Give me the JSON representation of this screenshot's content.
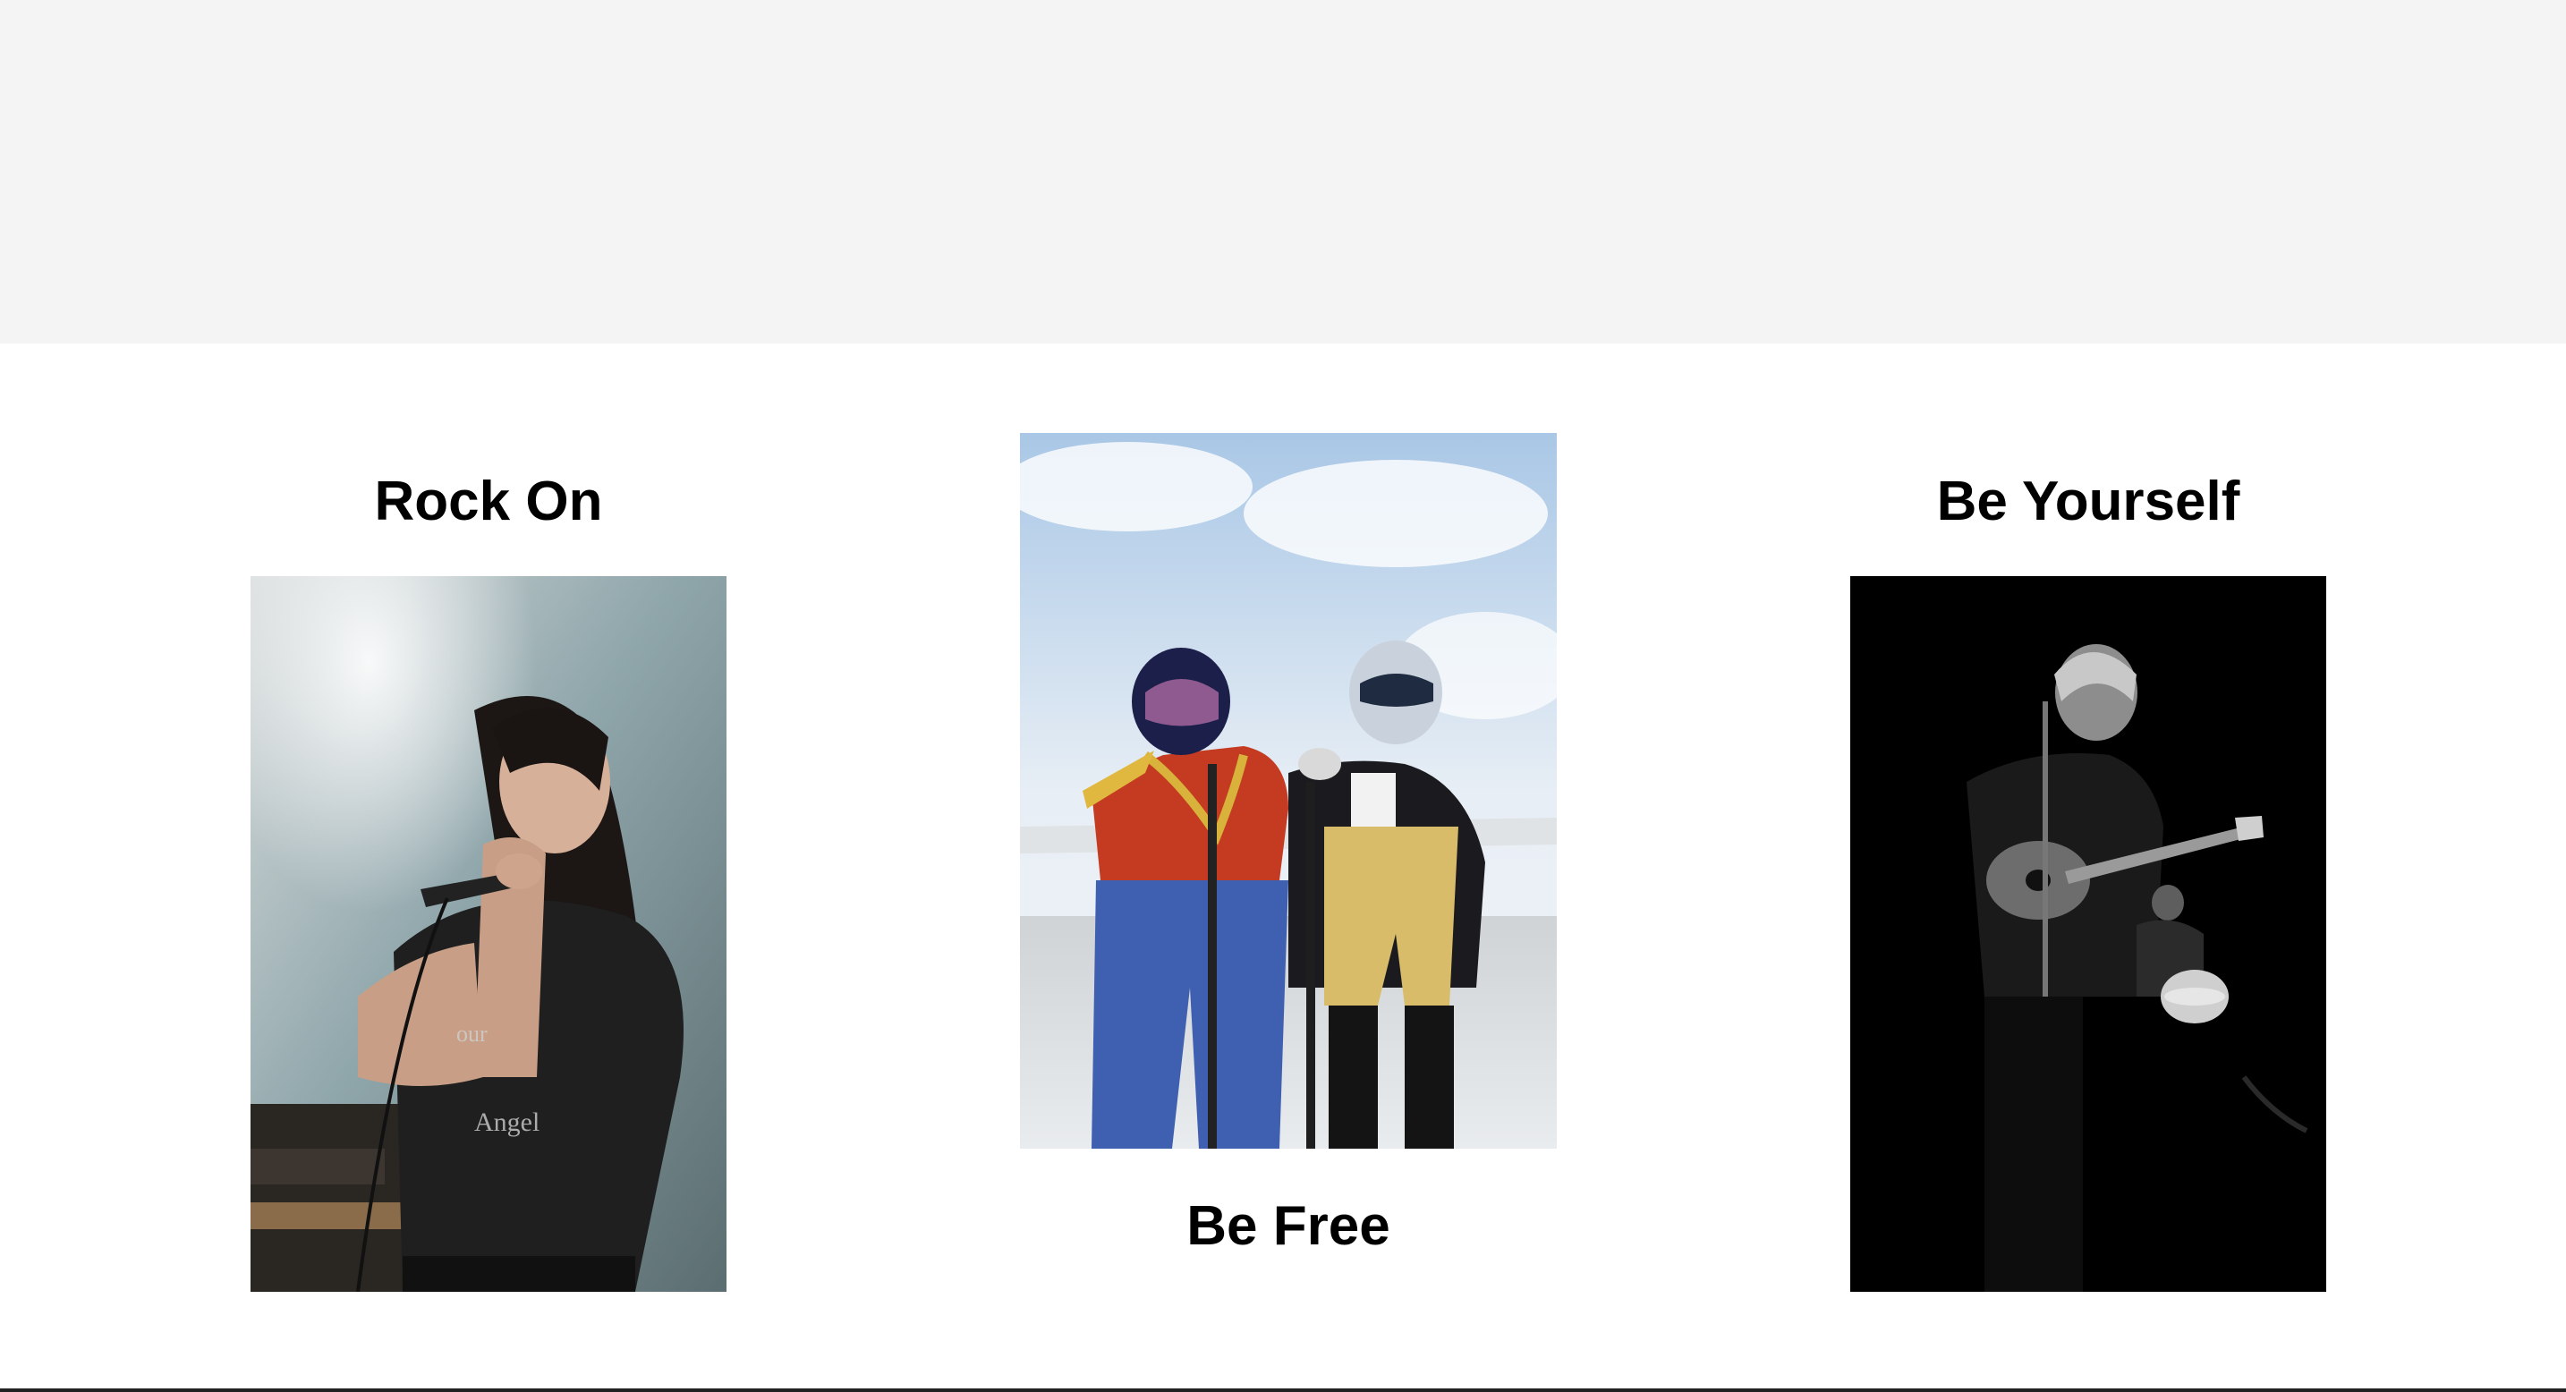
{
  "gallery": {
    "cards": [
      {
        "title": "Rock On"
      },
      {
        "title": "Be Free"
      },
      {
        "title": "Be Yourself"
      }
    ]
  },
  "colors": {
    "top_band": "#f4f4f4",
    "background": "#ffffff",
    "title_text": "#000000",
    "bottom_rule": "#222222"
  }
}
